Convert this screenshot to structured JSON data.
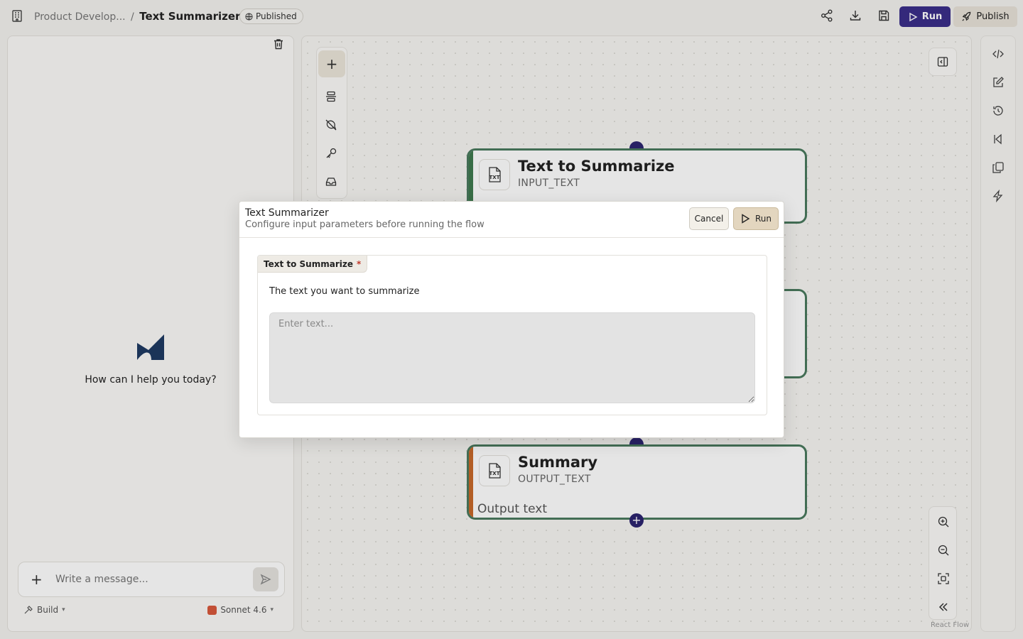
{
  "header": {
    "breadcrumb_parent": "Product Develop...",
    "breadcrumb_separator": "/",
    "breadcrumb_current": "Text Summarizer",
    "status_badge": "Published",
    "run_label": "Run",
    "publish_label": "Publish"
  },
  "chat": {
    "greeting": "How can I help you today?",
    "input_placeholder": "Write a message...",
    "mode_label": "Build",
    "model_label": "Sonnet 4.6"
  },
  "canvas": {
    "nodes": [
      {
        "title": "Text to Summarize",
        "subtitle": "INPUT_TEXT",
        "accent": "#3f7a4f"
      },
      {
        "title": "Summary",
        "subtitle": "OUTPUT_TEXT",
        "body": "Output text",
        "accent": "#c8692a"
      }
    ],
    "attribution": "React Flow"
  },
  "modal": {
    "title": "Text Summarizer",
    "subtitle": "Configure input parameters before running the flow",
    "cancel_label": "Cancel",
    "run_label": "Run",
    "field": {
      "label": "Text to Summarize",
      "required_mark": "*",
      "description": "The text you want to summarize",
      "placeholder": "Enter text...",
      "value": ""
    }
  },
  "colors": {
    "primary": "#3a2e8a",
    "handle": "#2c2470",
    "node_border": "#4a7a5e"
  }
}
